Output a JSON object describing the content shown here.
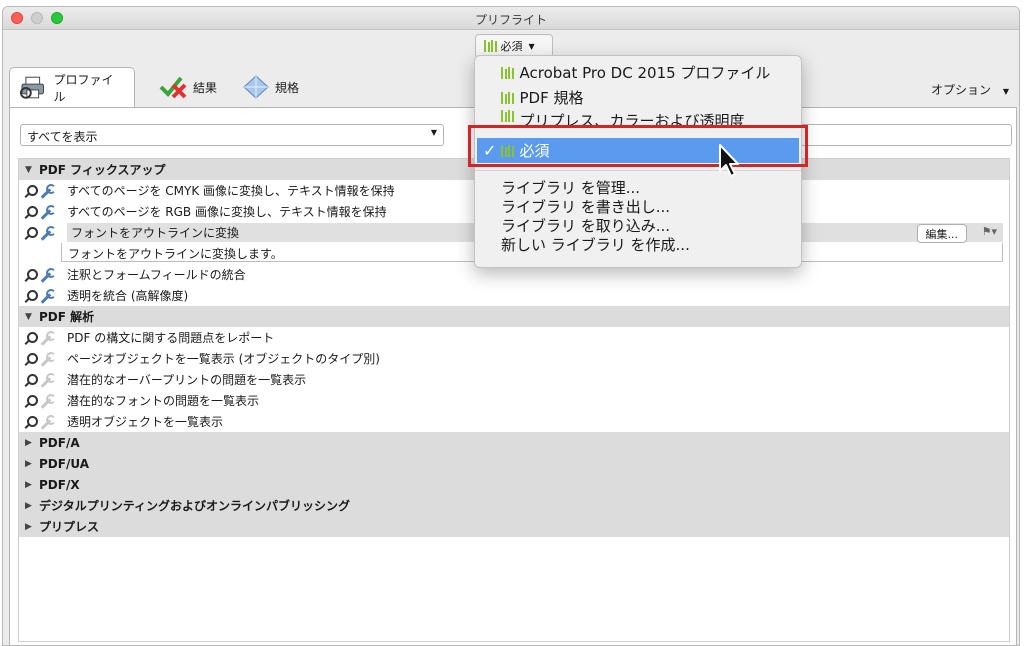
{
  "window": {
    "title": "プリフライト"
  },
  "library_button": {
    "label": "必須"
  },
  "tabs": [
    {
      "label": "プロファイル",
      "icon": "printer-icon"
    },
    {
      "label": "結果",
      "icon": "check-cross-icon"
    },
    {
      "label": "規格",
      "icon": "diamond-icon"
    }
  ],
  "options": {
    "label": "オプション"
  },
  "filter": {
    "value": "すべてを表示"
  },
  "groups": {
    "g1": {
      "label": "PDF フィックスアップ"
    },
    "g2": {
      "label": "PDF 解析"
    },
    "g3": {
      "label": "PDF/A"
    },
    "g4": {
      "label": "PDF/UA"
    },
    "g5": {
      "label": "PDF/X"
    },
    "g6": {
      "label": "デジタルプリンティングおよびオンラインパブリッシング"
    },
    "g7": {
      "label": "プリプレス"
    }
  },
  "fixups": [
    "すべてのページを CMYK 画像に変換し、テキスト情報を保持",
    "すべてのページを RGB 画像に変換し、テキスト情報を保持",
    "フォントをアウトラインに変換",
    "注釈とフォームフィールドの統合",
    "透明を統合 (高解像度)"
  ],
  "selected_description": "フォントをアウトラインに変換します。",
  "edit_button": {
    "label": "編集..."
  },
  "analysis": [
    "PDF の構文に関する問題点をレポート",
    "ページオブジェクトを一覧表示 (オブジェクトのタイプ別)",
    "潜在的なオーバープリントの問題を一覧表示",
    "潜在的なフォントの問題を一覧表示",
    "透明オブジェクトを一覧表示"
  ],
  "menu": {
    "libraries": [
      "Acrobat Pro DC 2015 プロファイル",
      "PDF 規格",
      "プリプレス、カラーおよび透明度",
      "必須"
    ],
    "actions": [
      "ライブラリ を管理...",
      "ライブラリ を書き出し...",
      "ライブラリ を取り込み...",
      "新しい ライブラリ を作成..."
    ]
  },
  "colors": {
    "accent": "#5b9bef",
    "highlight": "#d22525",
    "library_green": "#8bc230"
  }
}
